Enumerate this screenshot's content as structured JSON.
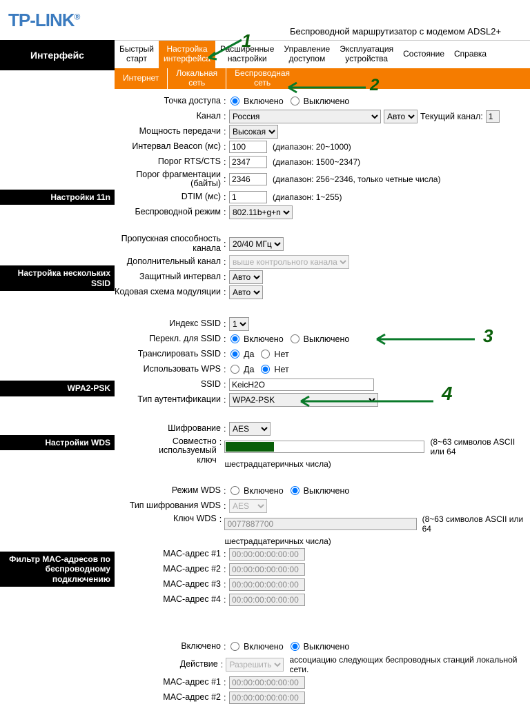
{
  "brand": "TP-LINK",
  "subtitle": "Беспроводной маршрутизатор с модемом ADSL2+",
  "leftTitle": "Интерфейс",
  "navMain": [
    "Быстрый\nстарт",
    "Настройка\nинтерфейса",
    "Расширенные\nнастройки",
    "Управление\nдоступом",
    "Эксплуатация\nустройства",
    "Состояние",
    "Справка"
  ],
  "subNav": [
    "Интернет",
    "Локальная\nсеть",
    "Беспроводная\nсеть"
  ],
  "sections": {
    "s11n": "Настройки 11n",
    "mssid": "Настройка нескольких SSID",
    "wpa2": "WPA2-PSK",
    "wds": "Настройки WDS",
    "macfilter": "Фильтр MAC-адресов по\nбеспроводному\nподключению"
  },
  "rows": {
    "ap_label": "Точка доступа",
    "ap_on": "Включено",
    "ap_off": "Выключено",
    "ch_label": "Канал",
    "ch_country": "Россия",
    "ch_auto": "Авто",
    "ch_cur_label": "Текущий канал:",
    "ch_cur": "1",
    "tx_label": "Мощность передачи",
    "tx_val": "Высокая",
    "beacon_label": "Интервал Beacon (мс)",
    "beacon_val": "100",
    "beacon_hint": "(диапазон: 20~1000)",
    "rts_label": "Порог RTS/CTS",
    "rts_val": "2347",
    "rts_hint": "(диапазон: 1500~2347)",
    "frag_label": "Порог фрагментации (байты)",
    "frag_val": "2346",
    "frag_hint": "(диапазон: 256~2346, только четные числа)",
    "dtim_label": "DTIM (мс)",
    "dtim_val": "1",
    "dtim_hint": "(диапазон: 1~255)",
    "mode_label": "Беспроводной режим",
    "mode_val": "802.11b+g+n",
    "bw_label": "Пропускная способность\nканала",
    "bw_val": "20/40 МГц",
    "ext_label": "Дополнительный канал",
    "ext_val": "выше контрольного канала",
    "gi_label": "Защитный интервал",
    "gi_val": "Авто",
    "mcs_label": "Кодовая схема модуляции",
    "mcs_val": "Авто",
    "ssididx_label": "Индекс SSID",
    "ssididx_val": "1",
    "perssid_label": "Перекл. для SSID",
    "perssid_on": "Включено",
    "perssid_off": "Выключено",
    "bcast_label": "Транслировать SSID",
    "yes": "Да",
    "no": "Нет",
    "wps_label": "Использовать WPS",
    "ssid_label": "SSID",
    "ssid_val": "KeicH2O",
    "auth_label": "Тип аутентификации",
    "auth_val": "WPA2-PSK",
    "enc_label": "Шифрование",
    "enc_val": "AES",
    "psk_label": "Совместно используемый\nключ",
    "psk_hint1": "(8~63 символов ASCII или 64",
    "psk_hint2": "шестрадцатеричных числа)",
    "wdsmode_label": "Режим WDS",
    "wdsenc_label": "Тип шифрования WDS",
    "wdsenc_val": "AES",
    "wdskey_label": "Ключ WDS",
    "wdskey_val": "0077887700",
    "wdskey_hint1": "(8~63 символов ASCII или 64",
    "wdskey_hint2": "шестрадцатеричных числа)",
    "mac1_label": "MAC-адрес #1",
    "mac1": "00:00:00:00:00:00",
    "mac2_label": "MAC-адрес #2",
    "mac2": "00:00:00:00:00:00",
    "mac3_label": "MAC-адрес #3",
    "mac3": "00:00:00:00:00:00",
    "mac4_label": "MAC-адрес #4",
    "mac4": "00:00:00:00:00:00",
    "flt_on_label": "Включено",
    "flt_act_label": "Действие",
    "flt_act_val": "Разрешить",
    "flt_act_hint": "ассоциацию следующих беспроводных станций локальной сети.",
    "flt_mac1_label": "MAC-адрес #1",
    "flt_mac1": "00:00:00:00:00:00",
    "flt_mac2_label": "MAC-адрес #2",
    "flt_mac2": "00:00:00:00:00:00"
  },
  "annotations": {
    "n1": "1",
    "n2": "2",
    "n3": "3",
    "n4": "4"
  }
}
